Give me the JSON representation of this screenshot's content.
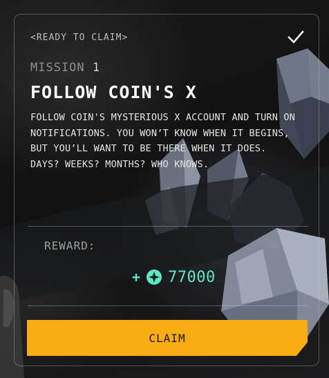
{
  "mission": {
    "status": "<READY TO CLAIM>",
    "number_prefix": "MISSION",
    "number": "1",
    "title": "FOLLOW COIN'S X",
    "description": "FOLLOW COIN'S MYSTERIOUS X ACCOUNT AND TURN ON NOTIFICATIONS. YOU WON’T KNOW WHEN IT BEGINS, BUT YOU’LL WANT TO BE THERE WHEN IT DOES. DAYS? WEEKS? MONTHS? WHO KNOWS.",
    "completed_icon": "check-icon"
  },
  "reward": {
    "label": "REWARD:",
    "plus": "+",
    "icon": "coin-icon",
    "amount": "77000",
    "color": "#63e6c8"
  },
  "claim_button": {
    "label": "CLAIM",
    "color": "#f8ad14"
  }
}
